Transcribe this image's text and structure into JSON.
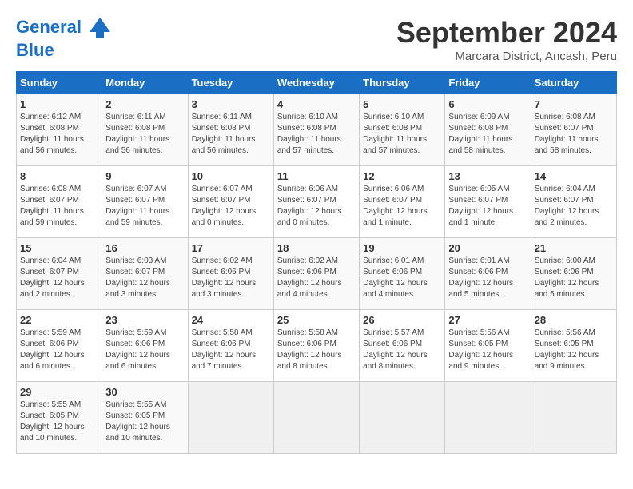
{
  "header": {
    "logo_line1": "General",
    "logo_line2": "Blue",
    "month_title": "September 2024",
    "subtitle": "Marcara District, Ancash, Peru"
  },
  "days_of_week": [
    "Sunday",
    "Monday",
    "Tuesday",
    "Wednesday",
    "Thursday",
    "Friday",
    "Saturday"
  ],
  "weeks": [
    [
      {
        "day": "1",
        "info": "Sunrise: 6:12 AM\nSunset: 6:08 PM\nDaylight: 11 hours\nand 56 minutes."
      },
      {
        "day": "2",
        "info": "Sunrise: 6:11 AM\nSunset: 6:08 PM\nDaylight: 11 hours\nand 56 minutes."
      },
      {
        "day": "3",
        "info": "Sunrise: 6:11 AM\nSunset: 6:08 PM\nDaylight: 11 hours\nand 56 minutes."
      },
      {
        "day": "4",
        "info": "Sunrise: 6:10 AM\nSunset: 6:08 PM\nDaylight: 11 hours\nand 57 minutes."
      },
      {
        "day": "5",
        "info": "Sunrise: 6:10 AM\nSunset: 6:08 PM\nDaylight: 11 hours\nand 57 minutes."
      },
      {
        "day": "6",
        "info": "Sunrise: 6:09 AM\nSunset: 6:08 PM\nDaylight: 11 hours\nand 58 minutes."
      },
      {
        "day": "7",
        "info": "Sunrise: 6:08 AM\nSunset: 6:07 PM\nDaylight: 11 hours\nand 58 minutes."
      }
    ],
    [
      {
        "day": "8",
        "info": "Sunrise: 6:08 AM\nSunset: 6:07 PM\nDaylight: 11 hours\nand 59 minutes."
      },
      {
        "day": "9",
        "info": "Sunrise: 6:07 AM\nSunset: 6:07 PM\nDaylight: 11 hours\nand 59 minutes."
      },
      {
        "day": "10",
        "info": "Sunrise: 6:07 AM\nSunset: 6:07 PM\nDaylight: 12 hours\nand 0 minutes."
      },
      {
        "day": "11",
        "info": "Sunrise: 6:06 AM\nSunset: 6:07 PM\nDaylight: 12 hours\nand 0 minutes."
      },
      {
        "day": "12",
        "info": "Sunrise: 6:06 AM\nSunset: 6:07 PM\nDaylight: 12 hours\nand 1 minute."
      },
      {
        "day": "13",
        "info": "Sunrise: 6:05 AM\nSunset: 6:07 PM\nDaylight: 12 hours\nand 1 minute."
      },
      {
        "day": "14",
        "info": "Sunrise: 6:04 AM\nSunset: 6:07 PM\nDaylight: 12 hours\nand 2 minutes."
      }
    ],
    [
      {
        "day": "15",
        "info": "Sunrise: 6:04 AM\nSunset: 6:07 PM\nDaylight: 12 hours\nand 2 minutes."
      },
      {
        "day": "16",
        "info": "Sunrise: 6:03 AM\nSunset: 6:07 PM\nDaylight: 12 hours\nand 3 minutes."
      },
      {
        "day": "17",
        "info": "Sunrise: 6:02 AM\nSunset: 6:06 PM\nDaylight: 12 hours\nand 3 minutes."
      },
      {
        "day": "18",
        "info": "Sunrise: 6:02 AM\nSunset: 6:06 PM\nDaylight: 12 hours\nand 4 minutes."
      },
      {
        "day": "19",
        "info": "Sunrise: 6:01 AM\nSunset: 6:06 PM\nDaylight: 12 hours\nand 4 minutes."
      },
      {
        "day": "20",
        "info": "Sunrise: 6:01 AM\nSunset: 6:06 PM\nDaylight: 12 hours\nand 5 minutes."
      },
      {
        "day": "21",
        "info": "Sunrise: 6:00 AM\nSunset: 6:06 PM\nDaylight: 12 hours\nand 5 minutes."
      }
    ],
    [
      {
        "day": "22",
        "info": "Sunrise: 5:59 AM\nSunset: 6:06 PM\nDaylight: 12 hours\nand 6 minutes."
      },
      {
        "day": "23",
        "info": "Sunrise: 5:59 AM\nSunset: 6:06 PM\nDaylight: 12 hours\nand 6 minutes."
      },
      {
        "day": "24",
        "info": "Sunrise: 5:58 AM\nSunset: 6:06 PM\nDaylight: 12 hours\nand 7 minutes."
      },
      {
        "day": "25",
        "info": "Sunrise: 5:58 AM\nSunset: 6:06 PM\nDaylight: 12 hours\nand 8 minutes."
      },
      {
        "day": "26",
        "info": "Sunrise: 5:57 AM\nSunset: 6:06 PM\nDaylight: 12 hours\nand 8 minutes."
      },
      {
        "day": "27",
        "info": "Sunrise: 5:56 AM\nSunset: 6:05 PM\nDaylight: 12 hours\nand 9 minutes."
      },
      {
        "day": "28",
        "info": "Sunrise: 5:56 AM\nSunset: 6:05 PM\nDaylight: 12 hours\nand 9 minutes."
      }
    ],
    [
      {
        "day": "29",
        "info": "Sunrise: 5:55 AM\nSunset: 6:05 PM\nDaylight: 12 hours\nand 10 minutes."
      },
      {
        "day": "30",
        "info": "Sunrise: 5:55 AM\nSunset: 6:05 PM\nDaylight: 12 hours\nand 10 minutes."
      },
      {
        "day": "",
        "info": ""
      },
      {
        "day": "",
        "info": ""
      },
      {
        "day": "",
        "info": ""
      },
      {
        "day": "",
        "info": ""
      },
      {
        "day": "",
        "info": ""
      }
    ]
  ]
}
